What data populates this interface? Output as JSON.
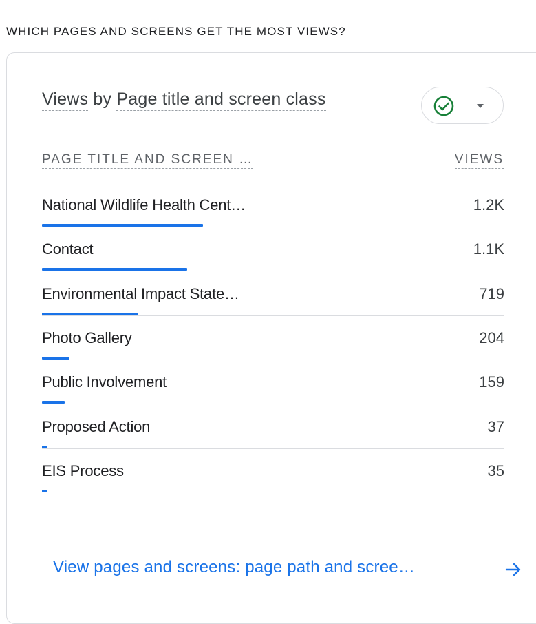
{
  "section": {
    "title": "WHICH PAGES AND SCREENS GET THE MOST VIEWS?"
  },
  "card": {
    "heading_metric": "Views",
    "heading_by": "by",
    "heading_dimension": "Page title and screen class",
    "status_icon": "check-circle-icon",
    "status_color": "#188038",
    "dropdown_icon": "caret-down-icon"
  },
  "table": {
    "col_dimension": "PAGE TITLE AND SCREEN …",
    "col_metric": "VIEWS",
    "rows": [
      {
        "label": "National Wildlife Health Cent…",
        "value": "1.2K",
        "share": 1.0
      },
      {
        "label": "Contact",
        "value": "1.1K",
        "share": 0.9
      },
      {
        "label": "Environmental Impact State…",
        "value": "719",
        "share": 0.6
      },
      {
        "label": "Photo Gallery",
        "value": "204",
        "share": 0.17
      },
      {
        "label": "Public Involvement",
        "value": "159",
        "share": 0.14
      },
      {
        "label": "Proposed Action",
        "value": "37",
        "share": 0.03
      },
      {
        "label": "EIS Process",
        "value": "35",
        "share": 0.03
      }
    ]
  },
  "footer": {
    "link_label": "View pages and screens: page path and scree…",
    "link_icon": "arrow-right-icon",
    "accent_color": "#1a73e8"
  }
}
